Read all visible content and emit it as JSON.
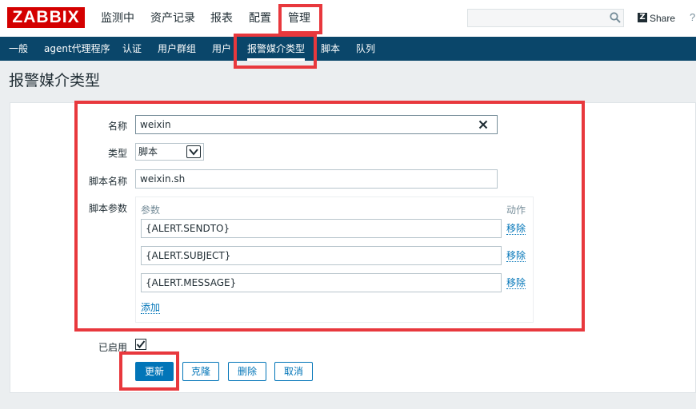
{
  "header": {
    "logo": "ZABBIX",
    "menu": [
      "监测中",
      "资产记录",
      "报表",
      "配置",
      "管理"
    ],
    "share_label": "Share",
    "help_label": "?"
  },
  "subnav": {
    "items": [
      "一般",
      "agent代理程序",
      "认证",
      "用户群组",
      "用户",
      "报警媒介类型",
      "脚本",
      "队列"
    ],
    "active": "报警媒介类型"
  },
  "page": {
    "title": "报警媒介类型"
  },
  "form": {
    "name_label": "名称",
    "name_value": "weixin",
    "type_label": "类型",
    "type_value": "脚本",
    "script_name_label": "脚本名称",
    "script_name_value": "weixin.sh",
    "script_params_label": "脚本参数",
    "params_header": "参数",
    "action_header": "动作",
    "params": [
      {
        "value": "{ALERT.SENDTO}",
        "remove_label": "移除"
      },
      {
        "value": "{ALERT.SUBJECT}",
        "remove_label": "移除"
      },
      {
        "value": "{ALERT.MESSAGE}",
        "remove_label": "移除"
      }
    ],
    "add_label": "添加",
    "enabled_label": "已启用",
    "enabled": true
  },
  "buttons": {
    "update": "更新",
    "clone": "克隆",
    "delete": "删除",
    "cancel": "取消"
  },
  "colors": {
    "brand_red": "#d40000",
    "nav_blue": "#0a466a",
    "link_blue": "#0275b8",
    "highlight_red": "#e8383d"
  }
}
